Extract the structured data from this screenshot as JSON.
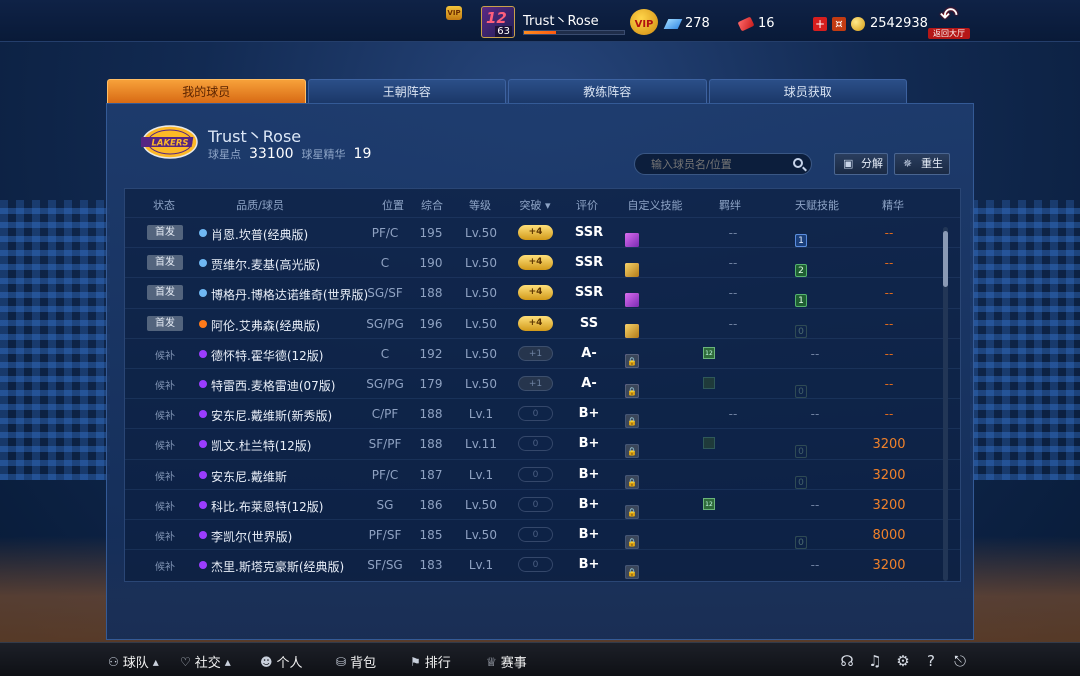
{
  "topbar": {
    "vip_badge": "VIP",
    "avatar_number": "12",
    "player_level": "63",
    "player_name": "Trust丶Rose",
    "xp_progress": 0.32,
    "vip_label": "VIP",
    "diamonds": "278",
    "tickets": "16",
    "coins": "2542938",
    "back_label": "返回大厅"
  },
  "tabs": [
    {
      "label": "我的球员",
      "active": true
    },
    {
      "label": "王朝阵容",
      "active": false
    },
    {
      "label": "教练阵容",
      "active": false
    },
    {
      "label": "球员获取",
      "active": false
    }
  ],
  "team": {
    "name": "Trust丶Rose",
    "star_points_label": "球星点",
    "star_points": "33100",
    "essence_label": "球星精华",
    "essence": "19"
  },
  "search": {
    "placeholder": "输入球员名/位置"
  },
  "buttons": {
    "decompose": "分解",
    "rebirth": "重生"
  },
  "columns": [
    "状态",
    "品质/球员",
    "位置",
    "综合",
    "等级",
    "突破",
    "评价",
    "自定义技能",
    "羁绊",
    "天赋技能",
    "精华"
  ],
  "colors": {
    "orange_quality": "#ff7a1a",
    "purple_quality": "#9b3dff",
    "blue_quality": "#6fb7f2",
    "accent": "#f0812a"
  },
  "players": [
    {
      "status": "首发",
      "quality": "blue",
      "name": "肖恩.坎普(经典版)",
      "pos": "PF/C",
      "ovr": "195",
      "lvl": "Lv.50",
      "brk": "+4",
      "brk_style": "gold",
      "grade": "SSR",
      "skills": [
        "g",
        "p",
        "p"
      ],
      "bond": "--",
      "talent": [
        {
          "v": "1",
          "c": "g"
        },
        {
          "v": "1",
          "c": "b"
        }
      ],
      "ess": "--"
    },
    {
      "status": "首发",
      "quality": "blue",
      "name": "贾维尔.麦基(高光版)",
      "pos": "C",
      "ovr": "190",
      "lvl": "Lv.50",
      "brk": "+4",
      "brk_style": "gold",
      "grade": "SSR",
      "skills": [
        "p",
        "p",
        "g"
      ],
      "bond": "--",
      "talent": [
        {
          "v": "2",
          "c": "g"
        }
      ],
      "ess": "--"
    },
    {
      "status": "首发",
      "quality": "blue",
      "name": "博格丹.博格达诺维奇(世界版)",
      "pos": "SG/SF",
      "ovr": "188",
      "lvl": "Lv.50",
      "brk": "+4",
      "brk_style": "gold",
      "grade": "SSR",
      "skills": [
        "p",
        "g",
        "p"
      ],
      "bond": "--",
      "talent": [
        {
          "v": "1",
          "c": "g"
        }
      ],
      "ess": "--"
    },
    {
      "status": "首发",
      "quality": "orange",
      "name": "阿伦.艾弗森(经典版)",
      "pos": "SG/PG",
      "ovr": "196",
      "lvl": "Lv.50",
      "brk": "+4",
      "brk_style": "gold",
      "grade": "SS",
      "skills": [
        "p",
        "p",
        "g"
      ],
      "bond": "--",
      "talent": [
        {
          "v": "0",
          "c": "dim"
        },
        {
          "v": "0",
          "c": "dim"
        }
      ],
      "ess": "--"
    },
    {
      "status": "候补",
      "quality": "purple",
      "name": "德怀特.霍华德(12版)",
      "pos": "C",
      "ovr": "192",
      "lvl": "Lv.50",
      "brk": "+1",
      "brk_style": "dim",
      "grade": "A-",
      "skills": [
        "p",
        "lock"
      ],
      "bond": "12",
      "talent": [],
      "ess": "--"
    },
    {
      "status": "候补",
      "quality": "purple",
      "name": "特雷西.麦格雷迪(07版)",
      "pos": "SG/PG",
      "ovr": "179",
      "lvl": "Lv.50",
      "brk": "+1",
      "brk_style": "dim",
      "grade": "A-",
      "skills": [
        "p",
        "lock"
      ],
      "bond": "dim",
      "talent": [
        {
          "v": "0",
          "c": "dim"
        }
      ],
      "ess": "--"
    },
    {
      "status": "候补",
      "quality": "purple",
      "name": "安东尼.戴维斯(新秀版)",
      "pos": "C/PF",
      "ovr": "188",
      "lvl": "Lv.1",
      "brk": "0",
      "brk_style": "empty",
      "grade": "B+",
      "skills": [
        "lock",
        "blank"
      ],
      "bond": "--",
      "talent": [],
      "ess": "--"
    },
    {
      "status": "候补",
      "quality": "purple",
      "name": "凯文.杜兰特(12版)",
      "pos": "SF/PF",
      "ovr": "188",
      "lvl": "Lv.11",
      "brk": "0",
      "brk_style": "empty",
      "grade": "B+",
      "skills": [
        "lock",
        "blank"
      ],
      "bond": "dim",
      "talent": [
        {
          "v": "0",
          "c": "dim"
        }
      ],
      "ess": "3200"
    },
    {
      "status": "候补",
      "quality": "purple",
      "name": "安东尼.戴维斯",
      "pos": "PF/C",
      "ovr": "187",
      "lvl": "Lv.1",
      "brk": "0",
      "brk_style": "empty",
      "grade": "B+",
      "skills": [
        "lock",
        "blank"
      ],
      "bond": "",
      "talent": [
        {
          "v": "0",
          "c": "dim"
        }
      ],
      "ess": "3200"
    },
    {
      "status": "候补",
      "quality": "purple",
      "name": "科比.布莱恩特(12版)",
      "pos": "SG",
      "ovr": "186",
      "lvl": "Lv.50",
      "brk": "0",
      "brk_style": "empty",
      "grade": "B+",
      "skills": [
        "lock",
        "blank"
      ],
      "bond": "12",
      "talent": [],
      "ess": "3200"
    },
    {
      "status": "候补",
      "quality": "purple",
      "name": "李凯尔(世界版)",
      "pos": "PF/SF",
      "ovr": "185",
      "lvl": "Lv.50",
      "brk": "0",
      "brk_style": "empty",
      "grade": "B+",
      "skills": [
        "lock",
        "blank"
      ],
      "bond": "",
      "talent": [
        {
          "v": "0",
          "c": "dim"
        },
        {
          "v": "0",
          "c": "dim"
        }
      ],
      "ess": "8000"
    },
    {
      "status": "候补",
      "quality": "purple",
      "name": "杰里.斯塔克豪斯(经典版)",
      "pos": "SF/SG",
      "ovr": "183",
      "lvl": "Lv.1",
      "brk": "0",
      "brk_style": "empty",
      "grade": "B+",
      "skills": [
        "lock",
        "blank"
      ],
      "bond": "",
      "talent": [],
      "ess": "3200"
    }
  ],
  "bottombar": [
    {
      "label": "球队",
      "icon": "user-icon",
      "caret": true
    },
    {
      "label": "社交",
      "icon": "heart-icon",
      "caret": true
    },
    {
      "label": "个人",
      "icon": "person-icon",
      "caret": false
    },
    {
      "label": "背包",
      "icon": "bag-icon",
      "caret": false
    },
    {
      "label": "排行",
      "icon": "rank-icon",
      "caret": false
    },
    {
      "label": "赛事",
      "icon": "trophy-icon",
      "caret": false
    }
  ],
  "right_icons": [
    "support-icon",
    "music-icon",
    "settings-icon",
    "help-icon",
    "exit-icon"
  ]
}
